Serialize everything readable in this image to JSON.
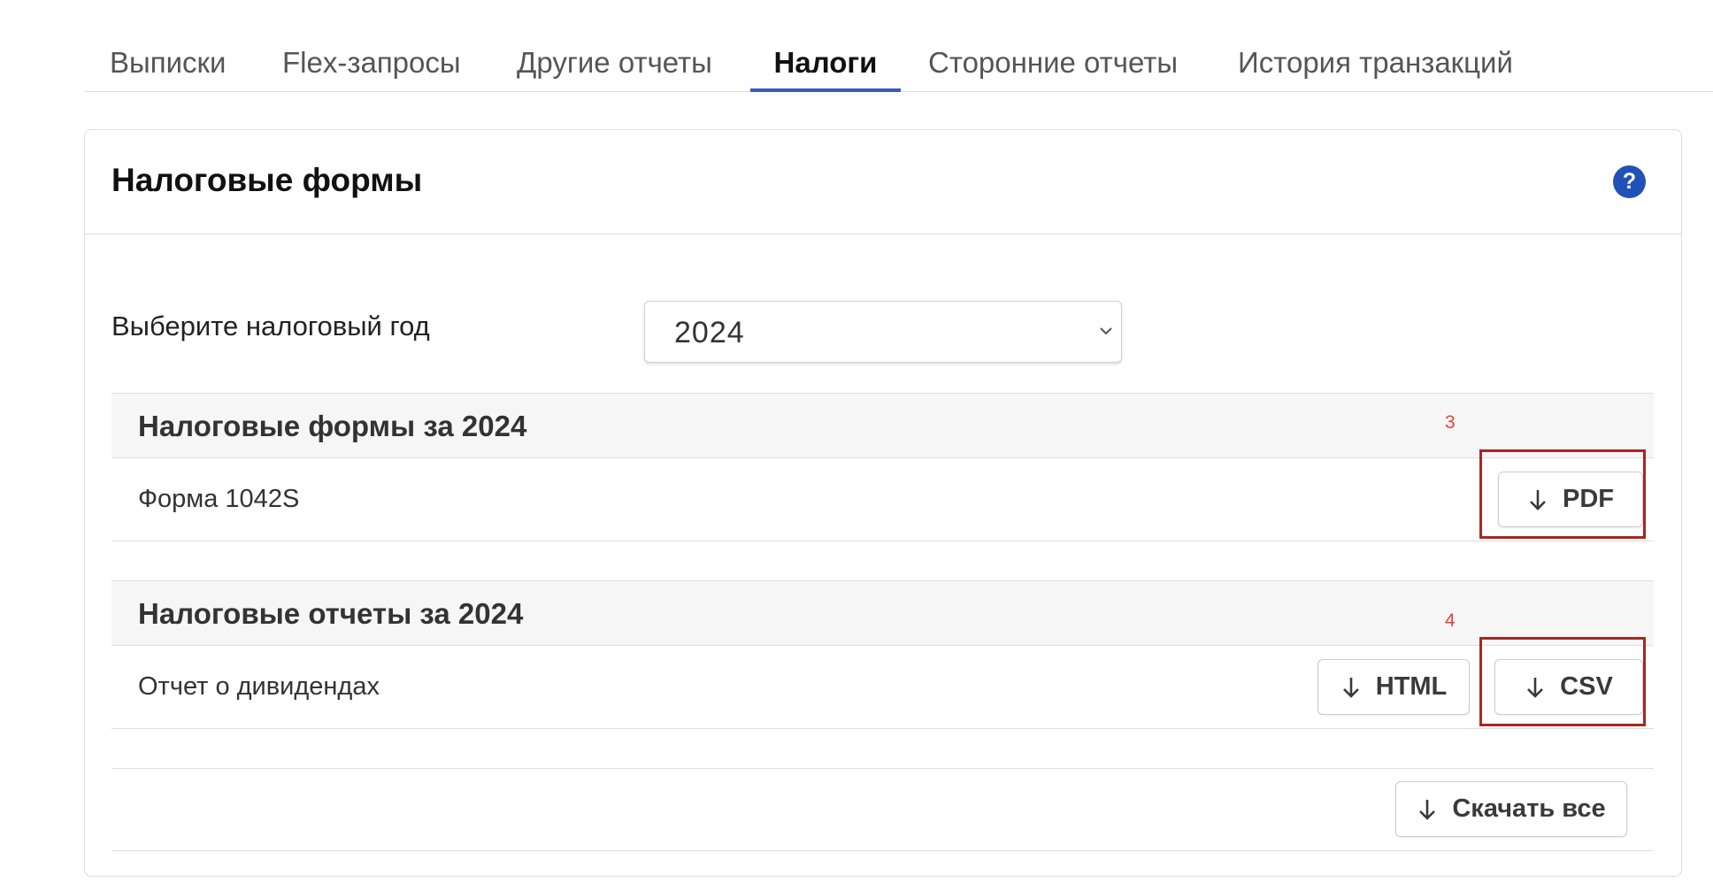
{
  "tabs": [
    {
      "label": "Выписки",
      "active": false
    },
    {
      "label": "Flex-запросы",
      "active": false
    },
    {
      "label": "Другие отчеты",
      "active": false
    },
    {
      "label": "Налоги",
      "active": true
    },
    {
      "label": "Сторонние отчеты",
      "active": false
    },
    {
      "label": "История транзакций",
      "active": false
    }
  ],
  "card": {
    "title": "Налоговые формы",
    "help_icon": "question-mark",
    "help_glyph": "?"
  },
  "year_selector": {
    "label": "Выберите налоговый год",
    "selected": "2024"
  },
  "forms_section": {
    "title": "Налоговые формы за 2024",
    "rows": [
      {
        "label": "Форма 1042S",
        "buttons": [
          "PDF"
        ]
      }
    ]
  },
  "reports_section": {
    "title": "Налоговые отчеты за 2024",
    "rows": [
      {
        "label": "Отчет о дивидендах",
        "buttons": [
          "HTML",
          "CSV"
        ]
      }
    ]
  },
  "footer": {
    "download_all_label": "Скачать все"
  },
  "annotations": [
    {
      "number": "3",
      "target": "PDF"
    },
    {
      "number": "4",
      "target": "CSV"
    }
  ],
  "colors": {
    "accent": "#3b5bb5",
    "help": "#2150b8",
    "annotation": "#a8271f",
    "annotation_number": "#e0453a"
  }
}
